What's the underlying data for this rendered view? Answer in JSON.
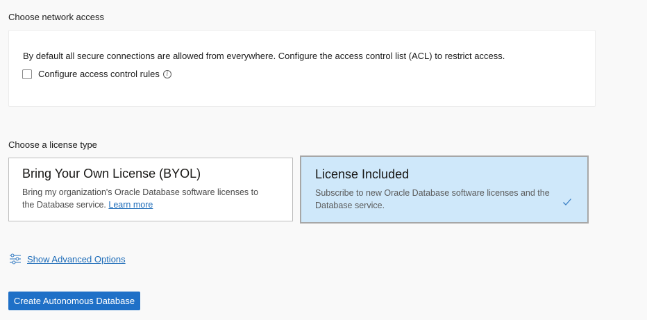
{
  "network": {
    "title": "Choose network access",
    "description": "By default all secure connections are allowed from everywhere. Configure the access control list (ACL) to restrict access.",
    "acl_label": "Configure access control rules",
    "acl_checked": false
  },
  "license": {
    "title": "Choose a license type",
    "options": [
      {
        "title": "Bring Your Own License (BYOL)",
        "description": "Bring my organization's Oracle Database software licenses to the Database service.",
        "link_label": "Learn more",
        "selected": false
      },
      {
        "title": "License Included",
        "description": "Subscribe to new Oracle Database software licenses and the Database service.",
        "selected": true
      }
    ]
  },
  "advanced": {
    "label": "Show Advanced Options",
    "icon": "sliders-icon"
  },
  "actions": {
    "create_label": "Create Autonomous Database"
  },
  "colors": {
    "accent": "#1f70c7",
    "link": "#1c6bb8",
    "selected_card": "#cfe8fa"
  }
}
